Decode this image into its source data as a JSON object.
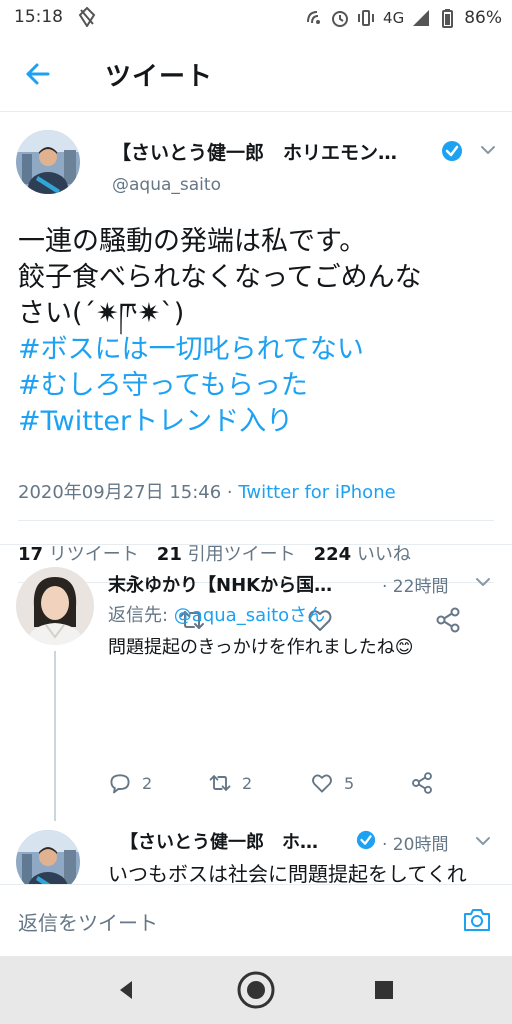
{
  "status_bar": {
    "time": "15:18",
    "network": "4G",
    "battery": "86%"
  },
  "header": {
    "title": "ツイート"
  },
  "tweet": {
    "author_name": "【さいとう健一郎　ホリエモン…",
    "handle": "@aqua_saito",
    "text_lines": [
      "一連の騒動の発端は私です。",
      "餃子食べられなくなってごめんな",
      "さい(´✷ཫ✷`)"
    ],
    "hashtags": [
      "#ボスには一切叱られてない",
      "#むしろ守ってもらった",
      "#Twitterトレンド入り"
    ],
    "timestamp": "2020年09月27日 15:46 · ",
    "source": "Twitter for iPhone",
    "stats": {
      "retweets_count": "17",
      "retweets_label": "リツイート",
      "quotes_count": "21",
      "quotes_label": "引用ツイート",
      "likes_count": "224",
      "likes_label": "いいね"
    }
  },
  "replies": [
    {
      "author_name": "末永ゆかり【NHKから国…",
      "time": "· 22時間",
      "reply_to_label": "返信先: ",
      "reply_to_handle": "@aqua_saitoさん",
      "text": "問題提起のきっかけを作れましたね😊",
      "reply_count": "2",
      "retweet_count": "2",
      "like_count": "5"
    },
    {
      "author_name": "【さいとう健一郎　ホ…",
      "time": "· 20時間",
      "text": "いつもボスは社会に問題提起をしてくれ"
    }
  ],
  "compose": {
    "placeholder": "返信をツイート"
  },
  "colors": {
    "accent": "#1da1f2",
    "secondary_text": "#657786",
    "divider": "#e6ecf0"
  }
}
